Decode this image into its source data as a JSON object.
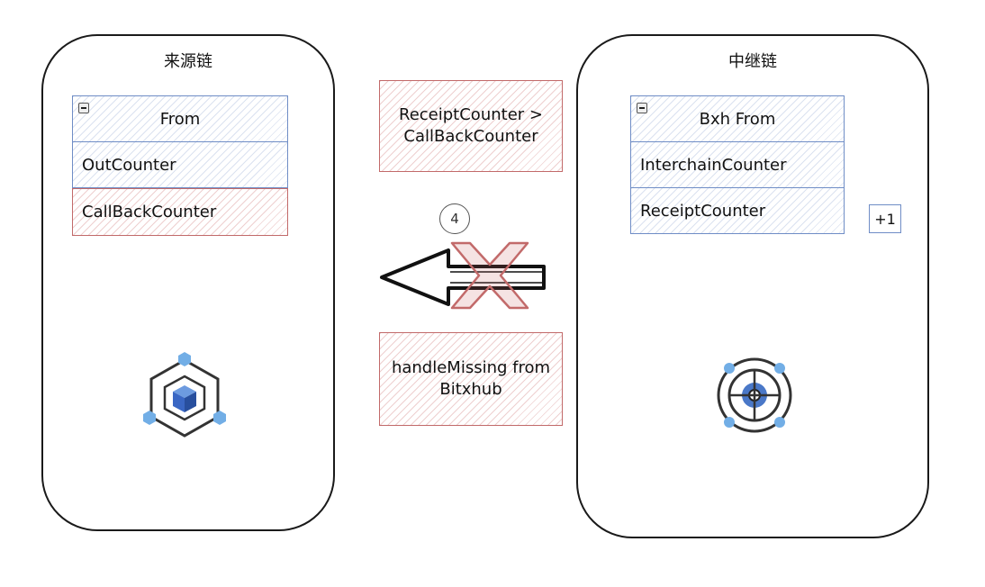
{
  "source_chain": {
    "title": "来源链",
    "table": {
      "header": "From",
      "rows": [
        "OutCounter",
        "CallBackCounter"
      ]
    }
  },
  "relay_chain": {
    "title": "中继链",
    "table": {
      "header": "Bxh From",
      "rows": [
        "InterchainCounter",
        "ReceiptCounter"
      ]
    },
    "increment_badge": "+1"
  },
  "notes": {
    "condition": "ReceiptCounter >\nCallBackCounter",
    "handler": "handleMissing from\nBitxhub"
  },
  "step_number": "4",
  "icons": {
    "source": "cube-network-icon",
    "relay": "target-hub-icon",
    "arrow": "arrow-left-icon",
    "blocked": "cross-x-icon",
    "collapse": "minus-collapse-icon"
  },
  "colors": {
    "blue_border": "#6f8dc6",
    "red_border": "#c26a6a",
    "icon_blue": "#4a78c8",
    "icon_light_blue": "#72aee6"
  }
}
